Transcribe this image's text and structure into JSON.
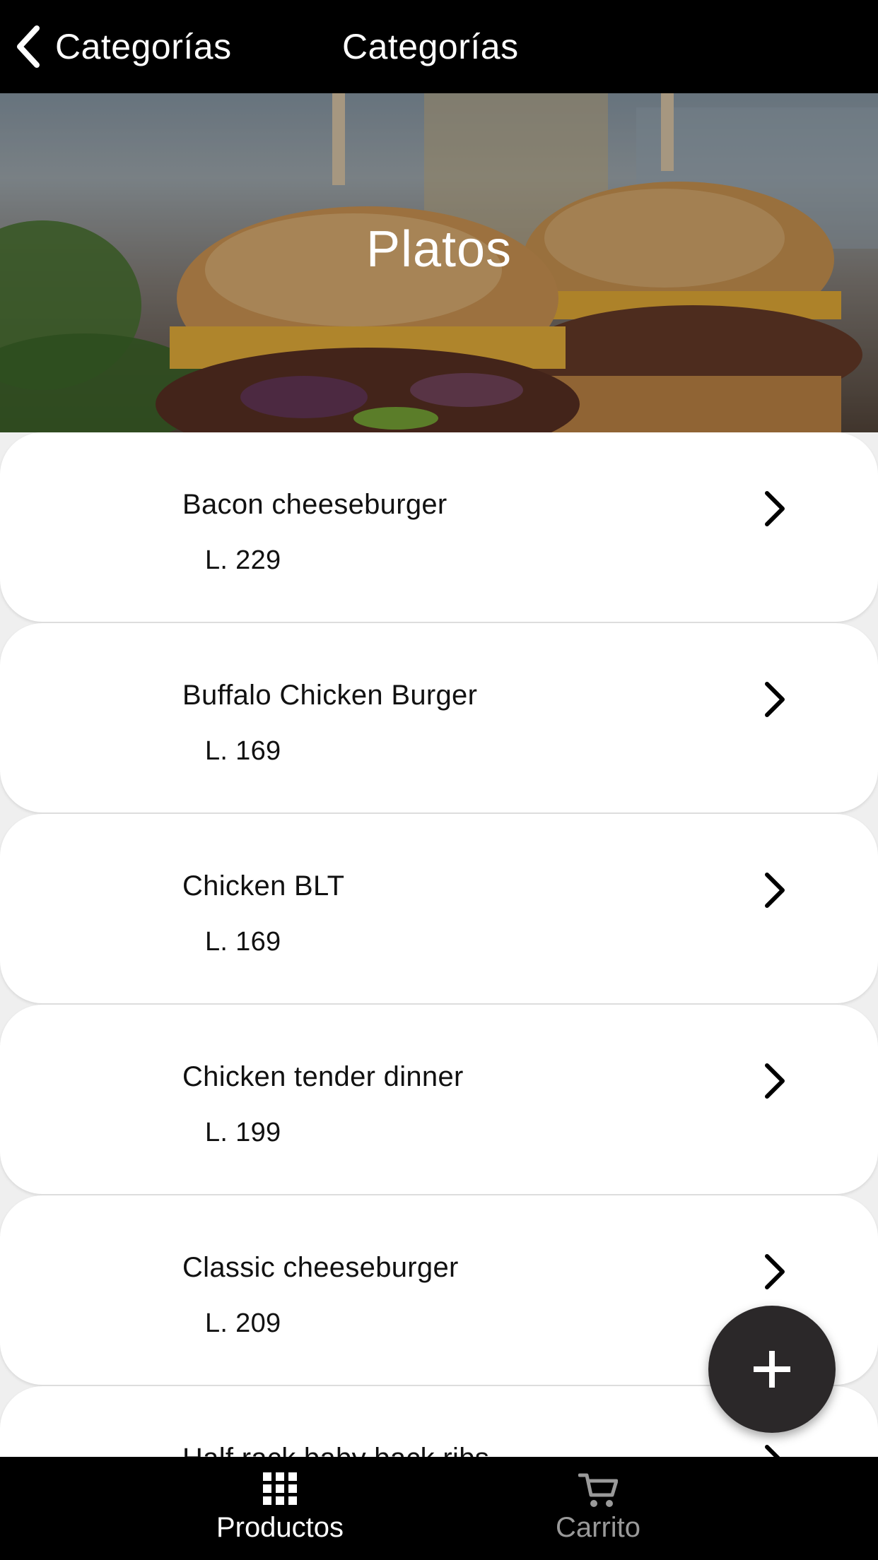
{
  "header": {
    "back_label": "Categorías",
    "title": "Categorías"
  },
  "hero": {
    "title": "Platos"
  },
  "products": [
    {
      "name": "Bacon cheeseburger",
      "price": "L. 229"
    },
    {
      "name": "Buffalo Chicken Burger",
      "price": "L. 169"
    },
    {
      "name": "Chicken BLT",
      "price": "L. 169"
    },
    {
      "name": "Chicken tender dinner",
      "price": "L. 199"
    },
    {
      "name": "Classic cheeseburger",
      "price": "L. 209"
    },
    {
      "name": "Half rack baby back ribs",
      "price": ""
    }
  ],
  "bottom_nav": {
    "productos_label": "Productos",
    "carrito_label": "Carrito"
  },
  "colors": {
    "header_bg": "#000000",
    "fab_bg": "#2b2829",
    "card_bg": "#ffffff",
    "inactive_tab": "#9a9a9a"
  }
}
